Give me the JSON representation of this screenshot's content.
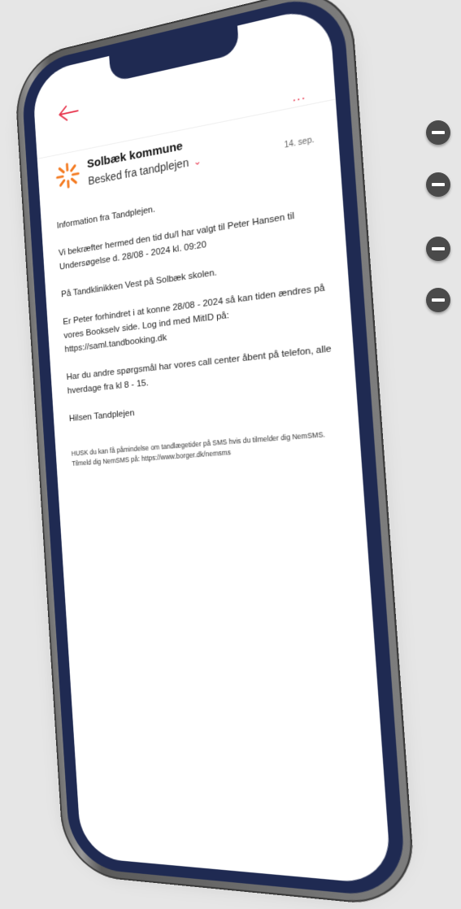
{
  "controls": {
    "side_buttons": [
      "minus",
      "minus",
      "minus",
      "minus"
    ],
    "back_icon": "arrow-left-icon",
    "more_icon": "more-horizontal-icon",
    "more_label": "..."
  },
  "message": {
    "sender": "Solbæk kommune",
    "subject": "Besked fra tandplejen",
    "date": "14. sep.",
    "body": [
      "Information fra Tandplejen.",
      "Vi bekræfter hermed den tid du/I har valgt til Peter Hansen til Undersøgelse d. 28/08 - 2024 kl. 09:20",
      "På Tandklinikken Vest på Solbæk skolen.",
      "Er Peter forhindret i at konne 28/08 - 2024 så kan tiden ændres på vores Bookselv side. Log ind med MitID på: https://saml.tandbooking.dk",
      "Har du andre spørgsmål har vores call center åbent på telefon, alle hverdage fra kl 8 - 15.",
      "Hilsen Tandplejen"
    ],
    "footer": "HUSK du kan få påmindelse om tandlægetider på SMS hvis du tilmelder dig NemSMS. Tilmeld dig NemSMS på: https://www.borger.dk/nemsms"
  },
  "colors": {
    "accent": "#e8384f",
    "logo_orange": "#f47a20",
    "bezel": "#1f2a52"
  }
}
